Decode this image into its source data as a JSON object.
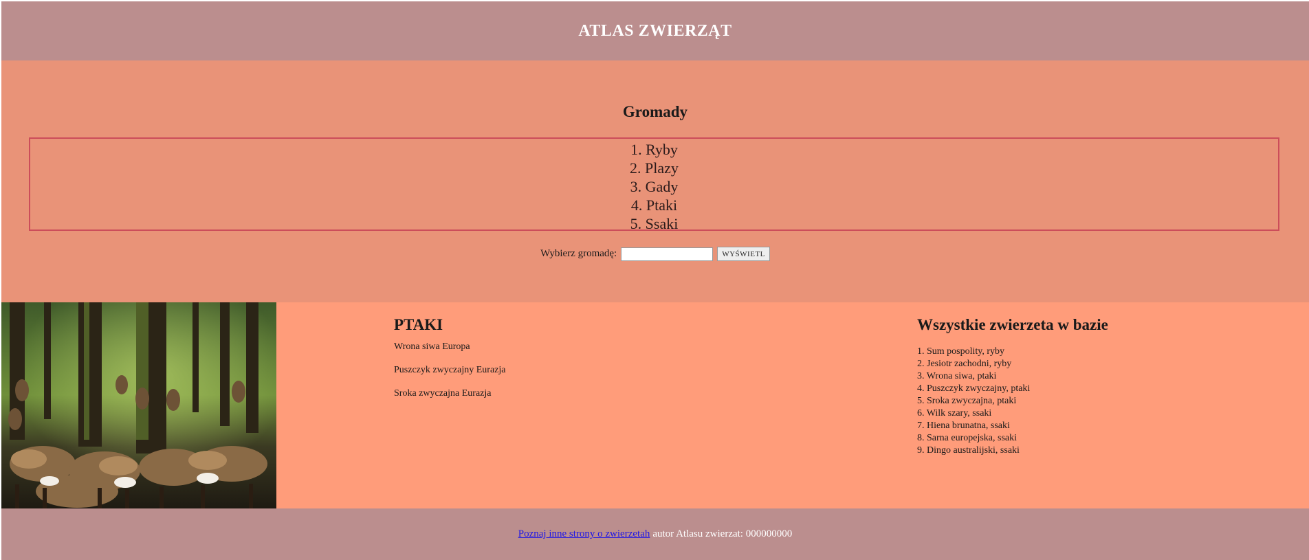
{
  "header": {
    "title": "ATLAS ZWIERZĄT"
  },
  "classes": {
    "heading": "Gromady",
    "items": [
      "1. Ryby",
      "2. Plazy",
      "3. Gady",
      "4. Ptaki",
      "5. Ssaki"
    ]
  },
  "form": {
    "label": "Wybierz gromadę:",
    "input_value": "",
    "button_label": "WYŚWIETL"
  },
  "photo": {
    "subject": "deer-herd-in-forest"
  },
  "birds": {
    "heading": "PTAKI",
    "items": [
      "Wrona siwa Europa",
      "Puszczyk zwyczajny Eurazja",
      "Sroka zwyczajna Eurazja"
    ]
  },
  "all_animals": {
    "heading": "Wszystkie zwierzeta w bazie",
    "items": [
      "1. Sum pospolity, ryby",
      "2. Jesiotr zachodni, ryby",
      "3. Wrona siwa, ptaki",
      "4. Puszczyk zwyczajny, ptaki",
      "5. Sroka zwyczajna, ptaki",
      "6. Wilk szary, ssaki",
      "7. Hiena brunatna, ssaki",
      "8. Sarna europejska, ssaki",
      "9. Dingo australijski, ssaki"
    ]
  },
  "footer": {
    "link_text": "Poznaj inne strony o zwierzetah",
    "author_text": "autor Atlasu zwierzat: 000000000"
  },
  "colors": {
    "header_bg": "#bb8e8e",
    "classes_bg": "#e99378",
    "middle_bg": "#ff9c7a",
    "list_border": "#cc4d5a",
    "link": "#1f16e6"
  }
}
